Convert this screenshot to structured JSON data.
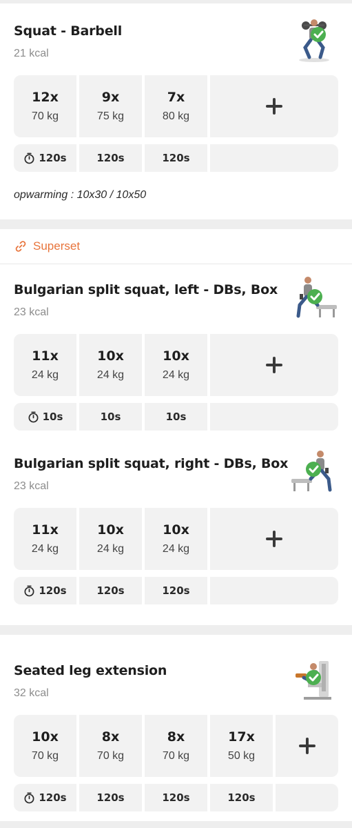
{
  "exercises": [
    {
      "title": "Squat - Barbell",
      "kcal": "21 kcal",
      "icon": "squat-barbell-illustration",
      "sets": [
        {
          "reps": "12x",
          "weight": "70 kg"
        },
        {
          "reps": "9x",
          "weight": "75 kg"
        },
        {
          "reps": "7x",
          "weight": "80 kg"
        }
      ],
      "rests": [
        "120s",
        "120s",
        "120s"
      ],
      "note": "opwarming : 10x30 / 10x50"
    },
    {
      "title": "Bulgarian split squat, left - DBs, Box",
      "kcal": "23 kcal",
      "icon": "split-squat-left-illustration",
      "sets": [
        {
          "reps": "11x",
          "weight": "24 kg"
        },
        {
          "reps": "10x",
          "weight": "24 kg"
        },
        {
          "reps": "10x",
          "weight": "24 kg"
        }
      ],
      "rests": [
        "10s",
        "10s",
        "10s"
      ]
    },
    {
      "title": "Bulgarian split squat, right - DBs, Box",
      "kcal": "23 kcal",
      "icon": "split-squat-right-illustration",
      "sets": [
        {
          "reps": "11x",
          "weight": "24 kg"
        },
        {
          "reps": "10x",
          "weight": "24 kg"
        },
        {
          "reps": "10x",
          "weight": "24 kg"
        }
      ],
      "rests": [
        "120s",
        "120s",
        "120s"
      ]
    },
    {
      "title": "Seated leg extension",
      "kcal": "32 kcal",
      "icon": "leg-extension-machine-illustration",
      "sets": [
        {
          "reps": "10x",
          "weight": "70 kg"
        },
        {
          "reps": "8x",
          "weight": "70 kg"
        },
        {
          "reps": "8x",
          "weight": "70 kg"
        },
        {
          "reps": "17x",
          "weight": "50 kg"
        }
      ],
      "rests": [
        "120s",
        "120s",
        "120s",
        "120s"
      ]
    }
  ],
  "superset": {
    "label": "Superset",
    "icon": "link-icon"
  },
  "icons": {
    "add": "plus-icon",
    "timer": "timer-icon",
    "completed": "check-circle-icon"
  },
  "colors": {
    "accent": "#e8743b",
    "completed": "#4caf50",
    "tile": "#f2f2f2",
    "background": "#eeeeee"
  }
}
